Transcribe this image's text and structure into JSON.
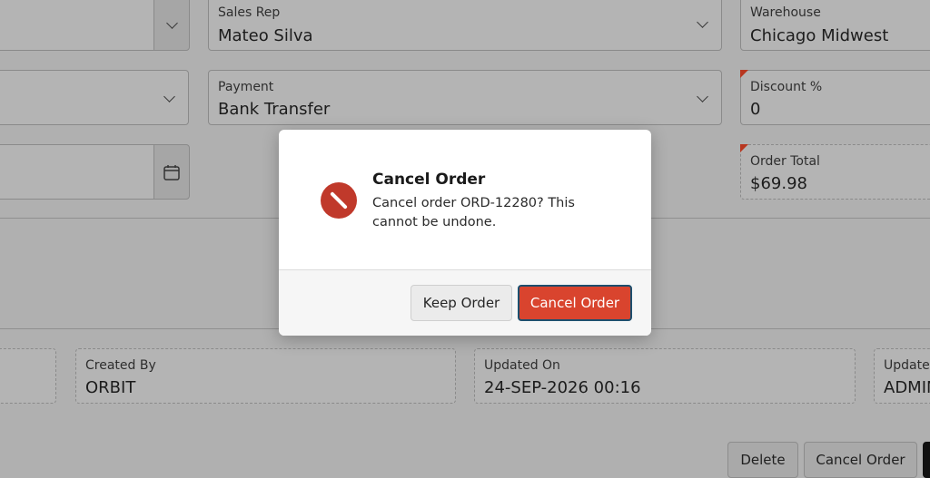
{
  "form": {
    "sales_rep": {
      "label": "Sales Rep",
      "value": "Mateo Silva"
    },
    "warehouse": {
      "label": "Warehouse",
      "value": "Chicago Midwest"
    },
    "payment": {
      "label": "Payment",
      "value": "Bank Transfer"
    },
    "discount": {
      "label": "Discount %",
      "value": "0"
    },
    "order_total": {
      "label": "Order Total",
      "value": "$69.98"
    },
    "created_by": {
      "label": "Created By",
      "value": "ORBIT"
    },
    "updated_on": {
      "label": "Updated On",
      "value": "24-SEP-2026 00:16"
    },
    "updated_by": {
      "label": "Updated",
      "value": "ADMIN"
    }
  },
  "actions": {
    "delete_label": "Delete",
    "cancel_order_label": "Cancel Order"
  },
  "dialog": {
    "title": "Cancel Order",
    "message": "Cancel order ORD-12280? This cannot be undone.",
    "keep_label": "Keep Order",
    "confirm_label": "Cancel Order",
    "icon": "cancel-icon",
    "accent_color": "#d9442e"
  }
}
